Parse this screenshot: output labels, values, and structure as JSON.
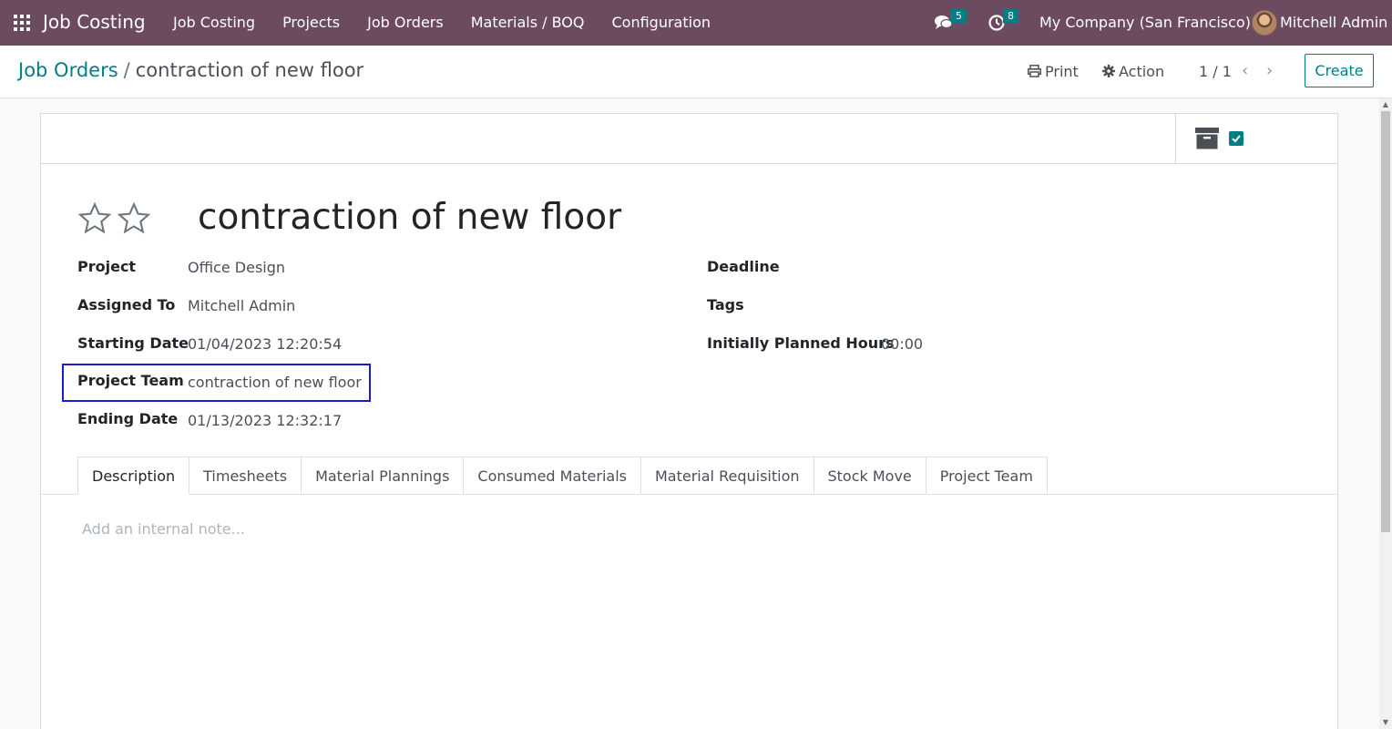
{
  "navbar": {
    "brand": "Job Costing",
    "menu": [
      "Job Costing",
      "Projects",
      "Job Orders",
      "Materials / BOQ",
      "Configuration"
    ],
    "messages_count": "5",
    "activities_count": "8",
    "company": "My Company (San Francisco)",
    "user": "Mitchell Admin"
  },
  "control_panel": {
    "breadcrumb_parent": "Job Orders",
    "breadcrumb_separator": "/",
    "breadcrumb_current": "contraction of new floor",
    "print_label": "Print",
    "action_label": "Action",
    "pager": "1 / 1",
    "create_label": "Create"
  },
  "form": {
    "title": "contraction of new floor",
    "left_fields": [
      {
        "label": "Project",
        "value": "Office Design"
      },
      {
        "label": "Assigned To",
        "value": "Mitchell Admin"
      },
      {
        "label": "Starting Date",
        "value": "01/04/2023 12:20:54"
      },
      {
        "label": "Project Team",
        "value": "contraction of new floor"
      },
      {
        "label": "Ending Date",
        "value": "01/13/2023 12:32:17"
      }
    ],
    "right_fields": [
      {
        "label": "Deadline",
        "value": ""
      },
      {
        "label": "Tags",
        "value": ""
      },
      {
        "label": "Initially Planned Hours",
        "value": "00:00"
      }
    ],
    "tabs": [
      "Description",
      "Timesheets",
      "Material Plannings",
      "Consumed Materials",
      "Material Requisition",
      "Stock Move",
      "Project Team"
    ],
    "active_tab": "Description",
    "note_placeholder": "Add an internal note..."
  },
  "colors": {
    "navbar": "#6c4b61",
    "accent": "#017e84",
    "highlight": "#1a1ad0"
  },
  "icons": [
    "apps-icon",
    "chat-icon",
    "clock-icon",
    "print-icon",
    "gear-icon",
    "chevron-left-icon",
    "chevron-right-icon",
    "archive-icon",
    "checkbox-icon",
    "star-icon"
  ]
}
